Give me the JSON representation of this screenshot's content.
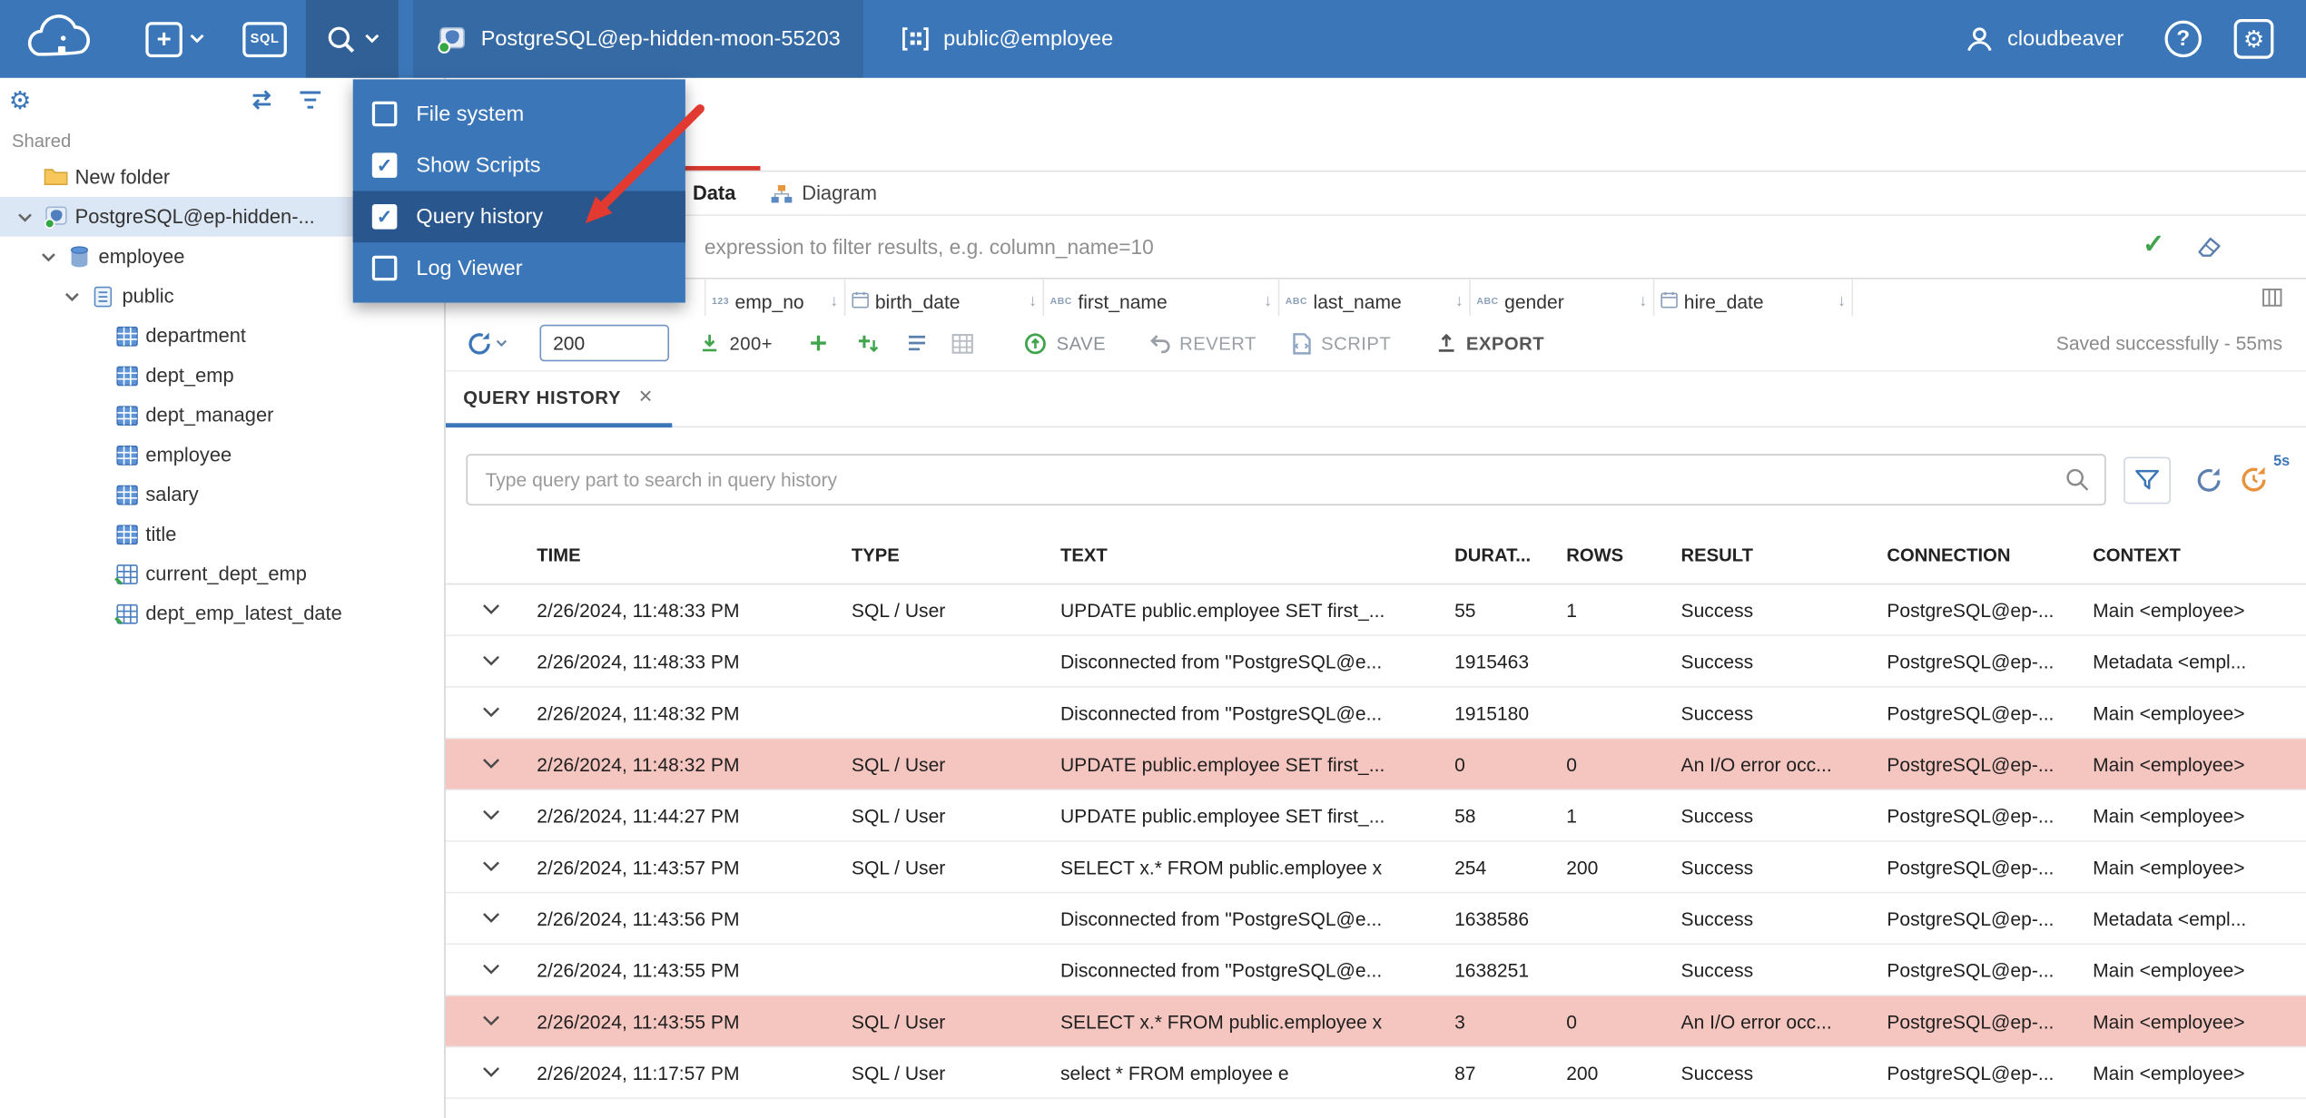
{
  "topbar": {
    "sql_label": "SQL",
    "connection_label": "PostgreSQL@ep-hidden-moon-55203",
    "schema_label": "public@employee",
    "user_label": "cloudbeaver",
    "help_label": "?"
  },
  "tools_menu": {
    "items": [
      {
        "label": "File system",
        "checked": false,
        "highlighted": false
      },
      {
        "label": "Show Scripts",
        "checked": true,
        "highlighted": false
      },
      {
        "label": "Query history",
        "checked": true,
        "highlighted": true
      },
      {
        "label": "Log Viewer",
        "checked": false,
        "highlighted": false
      }
    ]
  },
  "sidebar": {
    "section": "Shared",
    "tree": [
      {
        "label": "New folder",
        "icon": "folder",
        "indent": 0,
        "expander": false,
        "selected": false
      },
      {
        "label": "PostgreSQL@ep-hidden-...",
        "icon": "connection",
        "indent": 0,
        "expander": true,
        "selected": true
      },
      {
        "label": "employee",
        "icon": "database",
        "indent": 1,
        "expander": true,
        "selected": false
      },
      {
        "label": "public",
        "icon": "schema",
        "indent": 2,
        "expander": true,
        "selected": false
      },
      {
        "label": "department",
        "icon": "table",
        "indent": 3,
        "expander": false,
        "selected": false
      },
      {
        "label": "dept_emp",
        "icon": "table",
        "indent": 3,
        "expander": false,
        "selected": false
      },
      {
        "label": "dept_manager",
        "icon": "table",
        "indent": 3,
        "expander": false,
        "selected": false
      },
      {
        "label": "employee",
        "icon": "table",
        "indent": 3,
        "expander": false,
        "selected": false
      },
      {
        "label": "salary",
        "icon": "table",
        "indent": 3,
        "expander": false,
        "selected": false
      },
      {
        "label": "title",
        "icon": "table",
        "indent": 3,
        "expander": false,
        "selected": false
      },
      {
        "label": "current_dept_emp",
        "icon": "view",
        "indent": 3,
        "expander": false,
        "selected": false
      },
      {
        "label": "dept_emp_latest_date",
        "icon": "view",
        "indent": 3,
        "expander": false,
        "selected": false
      }
    ]
  },
  "tabs": {
    "data": "Data",
    "diagram": "Diagram"
  },
  "filter": {
    "placeholder": "expression to filter results, e.g. column_name=10"
  },
  "grid": {
    "columns": [
      {
        "label": "emp_no",
        "type": "num"
      },
      {
        "label": "birth_date",
        "type": "date"
      },
      {
        "label": "first_name",
        "type": "text"
      },
      {
        "label": "last_name",
        "type": "text"
      },
      {
        "label": "gender",
        "type": "text"
      },
      {
        "label": "hire_date",
        "type": "date"
      }
    ]
  },
  "toolbar": {
    "fetch_value": "200",
    "fetch_more": "200+",
    "save": "SAVE",
    "revert": "REVERT",
    "script": "SCRIPT",
    "export": "EXPORT",
    "status": "Saved successfully - 55ms"
  },
  "query_history": {
    "tab": "QUERY HISTORY",
    "search_placeholder": "Type query part to search in query history",
    "refresh_interval": "5s",
    "columns": [
      "TIME",
      "TYPE",
      "TEXT",
      "DURAT...",
      "ROWS",
      "RESULT",
      "CONNECTION",
      "CONTEXT"
    ],
    "rows": [
      {
        "time": "2/26/2024, 11:48:33 PM",
        "type": "SQL / User",
        "text": "UPDATE public.employee SET first_...",
        "duration": "55",
        "rows": "1",
        "result": "Success",
        "connection": "PostgreSQL@ep-...",
        "context": "Main <employee>",
        "error": false
      },
      {
        "time": "2/26/2024, 11:48:33 PM",
        "type": "",
        "text": "Disconnected from \"PostgreSQL@e...",
        "duration": "1915463",
        "rows": "",
        "result": "Success",
        "connection": "PostgreSQL@ep-...",
        "context": "Metadata <empl...",
        "error": false
      },
      {
        "time": "2/26/2024, 11:48:32 PM",
        "type": "",
        "text": "Disconnected from \"PostgreSQL@e...",
        "duration": "1915180",
        "rows": "",
        "result": "Success",
        "connection": "PostgreSQL@ep-...",
        "context": "Main <employee>",
        "error": false
      },
      {
        "time": "2/26/2024, 11:48:32 PM",
        "type": "SQL / User",
        "text": "UPDATE public.employee SET first_...",
        "duration": "0",
        "rows": "0",
        "result": "An I/O error occ...",
        "connection": "PostgreSQL@ep-...",
        "context": "Main <employee>",
        "error": true
      },
      {
        "time": "2/26/2024, 11:44:27 PM",
        "type": "SQL / User",
        "text": "UPDATE public.employee SET first_...",
        "duration": "58",
        "rows": "1",
        "result": "Success",
        "connection": "PostgreSQL@ep-...",
        "context": "Main <employee>",
        "error": false
      },
      {
        "time": "2/26/2024, 11:43:57 PM",
        "type": "SQL / User",
        "text": "SELECT x.* FROM public.employee x",
        "duration": "254",
        "rows": "200",
        "result": "Success",
        "connection": "PostgreSQL@ep-...",
        "context": "Main <employee>",
        "error": false
      },
      {
        "time": "2/26/2024, 11:43:56 PM",
        "type": "",
        "text": "Disconnected from \"PostgreSQL@e...",
        "duration": "1638586",
        "rows": "",
        "result": "Success",
        "connection": "PostgreSQL@ep-...",
        "context": "Metadata <empl...",
        "error": false
      },
      {
        "time": "2/26/2024, 11:43:55 PM",
        "type": "",
        "text": "Disconnected from \"PostgreSQL@e...",
        "duration": "1638251",
        "rows": "",
        "result": "Success",
        "connection": "PostgreSQL@ep-...",
        "context": "Main <employee>",
        "error": false
      },
      {
        "time": "2/26/2024, 11:43:55 PM",
        "type": "SQL / User",
        "text": "SELECT x.* FROM public.employee x",
        "duration": "3",
        "rows": "0",
        "result": "An I/O error occ...",
        "connection": "PostgreSQL@ep-...",
        "context": "Main <employee>",
        "error": true
      },
      {
        "time": "2/26/2024, 11:17:57 PM",
        "type": "SQL / User",
        "text": "select * FROM employee e",
        "duration": "87",
        "rows": "200",
        "result": "Success",
        "connection": "PostgreSQL@ep-...",
        "context": "Main <employee>",
        "error": false
      }
    ]
  },
  "colors": {
    "topbar_blue": "#3b76b8",
    "menu_highlight": "#29568d",
    "accent_red_tab": "#d6382f",
    "annotation_arrow": "#e23a31",
    "error_row": "#f5c6c0",
    "success_green": "#3fa44c"
  }
}
